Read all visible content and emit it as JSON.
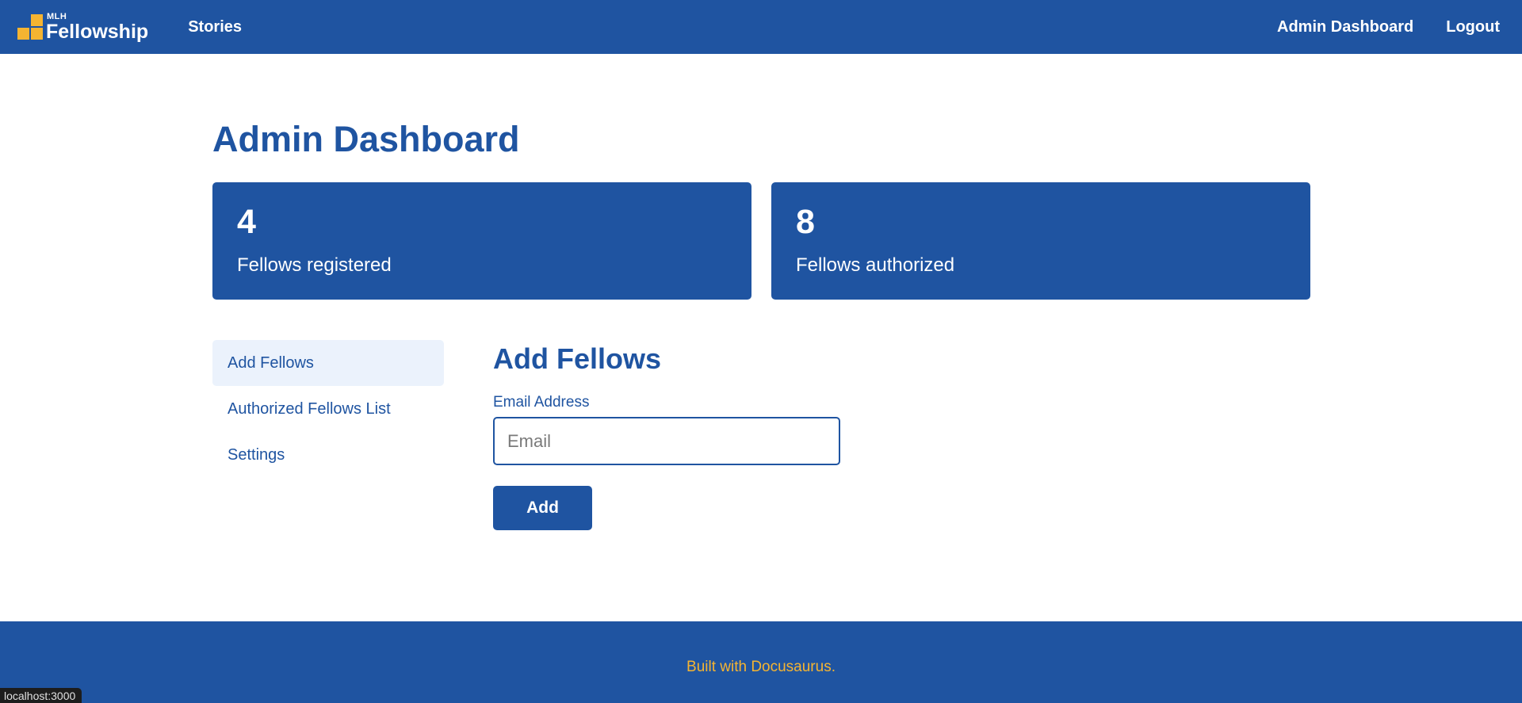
{
  "navbar": {
    "brand_small": "MLH",
    "brand_name": "Fellowship",
    "brand_color": "#f5b431",
    "stories_label": "Stories",
    "admin_dashboard_label": "Admin Dashboard",
    "logout_label": "Logout"
  },
  "page": {
    "title": "Admin Dashboard"
  },
  "stats": [
    {
      "value": "4",
      "label": "Fellows registered"
    },
    {
      "value": "8",
      "label": "Fellows authorized"
    }
  ],
  "sidebar": {
    "items": [
      {
        "label": "Add Fellows",
        "active": true
      },
      {
        "label": "Authorized Fellows List",
        "active": false
      },
      {
        "label": "Settings",
        "active": false
      }
    ]
  },
  "form": {
    "title": "Add Fellows",
    "email_label": "Email Address",
    "email_placeholder": "Email",
    "email_value": "",
    "submit_label": "Add"
  },
  "footer": {
    "text": "Built with Docusaurus."
  },
  "status_bar": {
    "url": "localhost:3000"
  },
  "colors": {
    "primary": "#1f54a1",
    "accent": "#f5b431",
    "active_bg": "#ebf2fc"
  }
}
